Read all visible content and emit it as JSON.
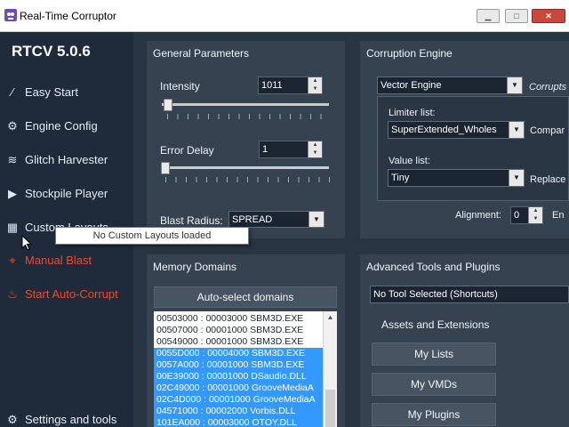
{
  "window": {
    "title": "Real-Time Corruptor",
    "minimize_icon": "minimize-icon",
    "maximize_icon": "maximize-icon",
    "close_icon": "close-icon",
    "minimize_glyph": "▁",
    "maximize_glyph": "□",
    "close_glyph": "✕"
  },
  "sidebar": {
    "brand": "RTCV 5.0.6",
    "items": [
      {
        "label": "Easy Start",
        "icon": "wand-icon",
        "glyph": "⁄"
      },
      {
        "label": "Engine Config",
        "icon": "gear-icon",
        "glyph": "⚙"
      },
      {
        "label": "Glitch Harvester",
        "icon": "layers-icon",
        "glyph": "≋"
      },
      {
        "label": "Stockpile Player",
        "icon": "play-icon",
        "glyph": "▶"
      },
      {
        "label": "Custom Layouts",
        "icon": "grid-icon",
        "glyph": "▦"
      },
      {
        "label": "Manual Blast",
        "icon": "crosshair-icon",
        "glyph": "⌖"
      },
      {
        "label": "Start Auto-Corrupt",
        "icon": "flame-icon",
        "glyph": "♨"
      },
      {
        "label": "Settings and tools",
        "icon": "settings-icon",
        "glyph": "⚙"
      }
    ]
  },
  "general": {
    "title": "General Parameters",
    "intensity_label": "Intensity",
    "intensity_value": "1011",
    "error_delay_label": "Error Delay",
    "error_delay_value": "1",
    "blast_radius_label": "Blast Radius:",
    "blast_radius_value": "SPREAD"
  },
  "corruption": {
    "title": "Corruption Engine",
    "engine_value": "Vector Engine",
    "side_label_1": "Corrupts",
    "limiter_label": "Limiter list:",
    "limiter_value": "SuperExtended_Wholes",
    "side_label_2": "Compar",
    "value_label": "Value list:",
    "value_value": "Tiny",
    "side_label_3": "Replace",
    "alignment_label": "Alignment:",
    "alignment_value": "0",
    "side_label_4": "En"
  },
  "memory": {
    "title": "Memory Domains",
    "auto_select_label": "Auto-select domains",
    "rows": [
      {
        "text": "00503000 : 00003000 SBM3D.EXE",
        "selected": false
      },
      {
        "text": "00507000 : 00001000 SBM3D.EXE",
        "selected": false
      },
      {
        "text": "00549000 : 00001000 SBM3D.EXE",
        "selected": false
      },
      {
        "text": "0055D000 : 00004000 SBM3D.EXE",
        "selected": true
      },
      {
        "text": "0057A000 : 00001000 SBM3D.EXE",
        "selected": true
      },
      {
        "text": "00E39000 : 00001000 DSaudio.DLL",
        "selected": true
      },
      {
        "text": "02C49000 : 00001000 GrooveMediaA",
        "selected": true
      },
      {
        "text": "02C4D000 : 00001000 GrooveMediaA",
        "selected": true
      },
      {
        "text": "04571000 : 00002000 Vorbis.DLL",
        "selected": true
      },
      {
        "text": "101EA000 : 00003000 OTOY.DLL",
        "selected": true
      }
    ]
  },
  "advanced": {
    "title": "Advanced Tools and Plugins",
    "tool_select_value": "No Tool Selected (Shortcuts)",
    "assets_label": "Assets and Extensions",
    "my_lists_label": "My Lists",
    "my_vmds_label": "My VMDs",
    "my_plugins_label": "My Plugins"
  },
  "tooltip": {
    "text": "No Custom Layouts loaded"
  }
}
